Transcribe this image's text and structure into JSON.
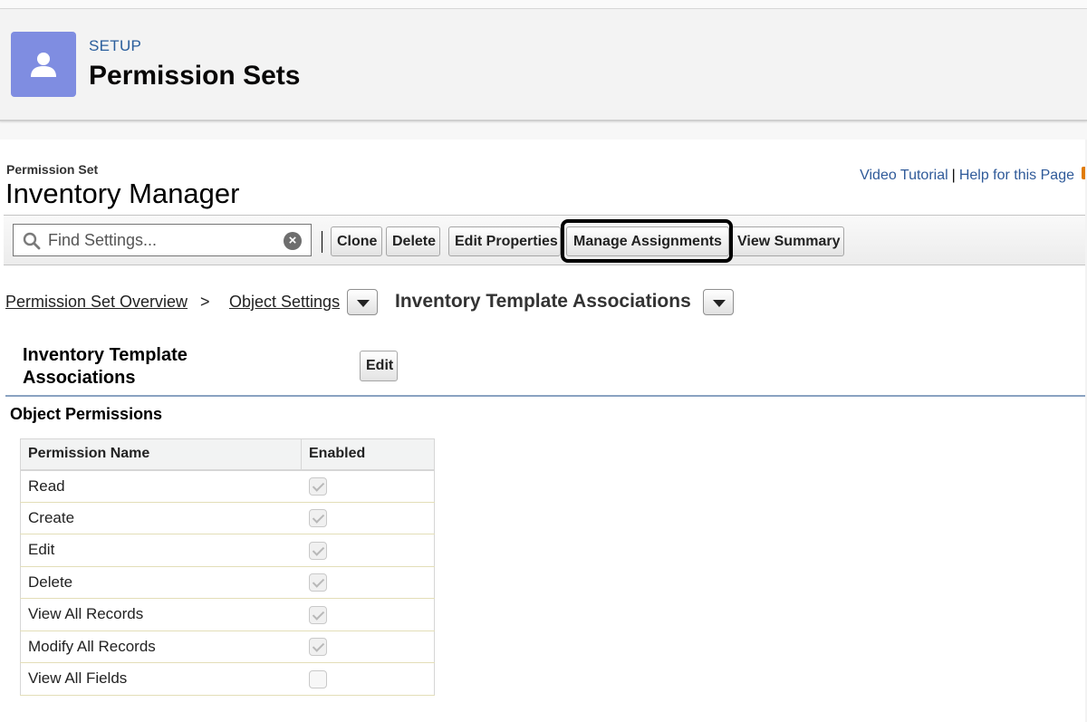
{
  "header": {
    "eyebrow": "SETUP",
    "title": "Permission Sets",
    "icon": "user-icon",
    "icon_color": "#7f8de1"
  },
  "record": {
    "label": "Permission Set",
    "name": "Inventory Manager"
  },
  "help_links": {
    "video_tutorial": "Video Tutorial",
    "separator": "|",
    "help_page": "Help for this Page"
  },
  "toolbar": {
    "search_placeholder": "Find Settings...",
    "buttons": {
      "clone": "Clone",
      "delete": "Delete",
      "edit_properties": "Edit Properties",
      "manage_assignments": "Manage Assignments",
      "view_summary": "View Summary"
    },
    "highlighted_button": "Manage Assignments"
  },
  "breadcrumb": {
    "overview": "Permission Set Overview",
    "separator": ">",
    "object_settings": "Object Settings",
    "current": "Inventory Template Associations"
  },
  "section": {
    "title": "Inventory Template Associations",
    "edit_label": "Edit",
    "subsection_title": "Object Permissions"
  },
  "permissions_table": {
    "columns": [
      "Permission Name",
      "Enabled"
    ],
    "rows": [
      {
        "name": "Read",
        "enabled": true
      },
      {
        "name": "Create",
        "enabled": true
      },
      {
        "name": "Edit",
        "enabled": true
      },
      {
        "name": "Delete",
        "enabled": true
      },
      {
        "name": "View All Records",
        "enabled": true
      },
      {
        "name": "Modify All Records",
        "enabled": true
      },
      {
        "name": "View All Fields",
        "enabled": false
      }
    ]
  }
}
